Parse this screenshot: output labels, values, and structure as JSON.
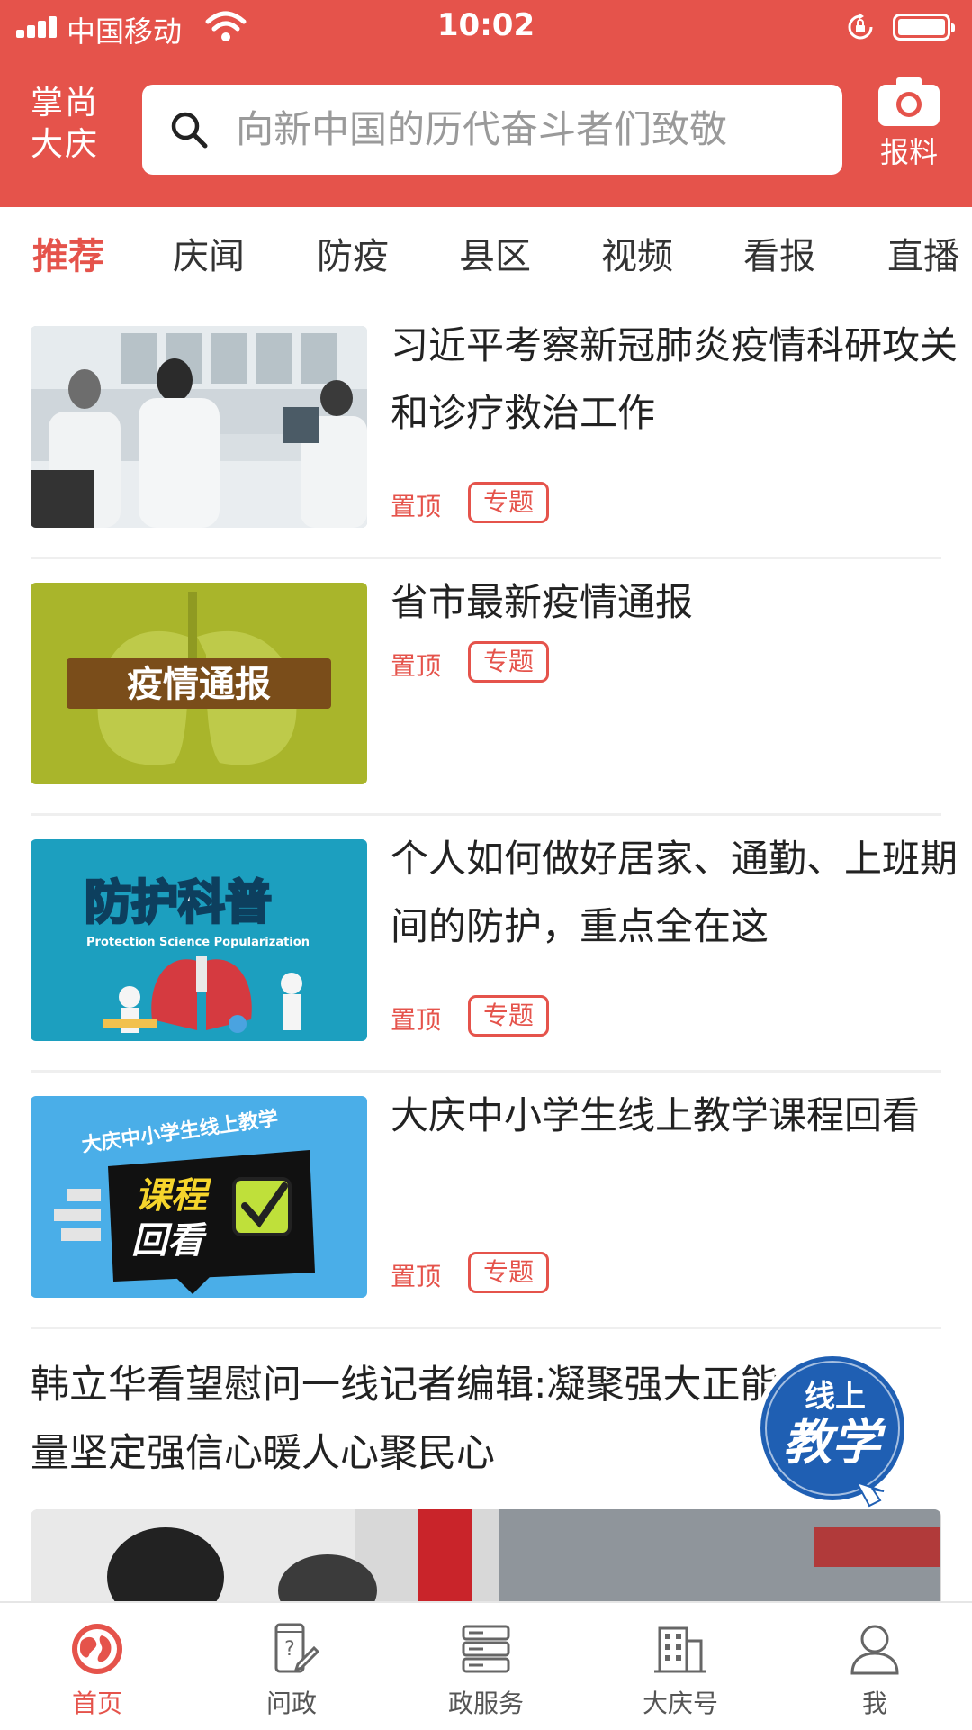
{
  "status_bar": {
    "carrier": "中国移动",
    "time": "10:02"
  },
  "header": {
    "brand": "掌尚大庆",
    "brand_line1": "掌尚",
    "brand_line2": "大庆",
    "search_placeholder": "向新中国的历代奋斗者们致敬",
    "report_label": "报料"
  },
  "tabs": [
    {
      "label": "推荐",
      "active": true
    },
    {
      "label": "庆闻",
      "active": false
    },
    {
      "label": "防疫",
      "active": false
    },
    {
      "label": "县区",
      "active": false
    },
    {
      "label": "视频",
      "active": false
    },
    {
      "label": "看报",
      "active": false
    },
    {
      "label": "直播",
      "active": false
    }
  ],
  "news": [
    {
      "title": "习近平考察新冠肺炎疫情科研攻关和诊疗救治工作",
      "pin_label": "置顶",
      "badge": "专题",
      "thumb": "lab-photo"
    },
    {
      "title": "省市最新疫情通报",
      "pin_label": "置顶",
      "badge": "专题",
      "thumb": "epidemic-report",
      "thumb_text": "疫情通报"
    },
    {
      "title": "个人如何做好居家、通勤、上班期间的防护，重点全在这",
      "pin_label": "置顶",
      "badge": "专题",
      "thumb": "protection-science",
      "thumb_text": "防护科普",
      "thumb_subtext": "Protection Science Popularization"
    },
    {
      "title": "大庆中小学生线上教学课程回看",
      "pin_label": "置顶",
      "badge": "专题",
      "thumb": "course-review",
      "thumb_text_top": "大庆中小学生线上教学",
      "thumb_text_line1": "课程",
      "thumb_text_line2": "回看"
    }
  ],
  "news5": {
    "title": "韩立华看望慰问一线记者编辑:凝聚强大正能量坚定强信心暖人心聚民心"
  },
  "floating_badge": {
    "line1": "线上",
    "line2": "教学"
  },
  "bottom_nav": [
    {
      "label": "首页",
      "icon": "globe-icon",
      "active": true
    },
    {
      "label": "问政",
      "icon": "phone-question-icon",
      "active": false
    },
    {
      "label": "政服务",
      "icon": "server-stack-icon",
      "active": false
    },
    {
      "label": "大庆号",
      "icon": "building-icon",
      "active": false
    },
    {
      "label": "我",
      "icon": "person-icon",
      "active": false
    }
  ],
  "colors": {
    "accent": "#e5534b",
    "text": "#222222",
    "muted": "#9a9a9a"
  }
}
